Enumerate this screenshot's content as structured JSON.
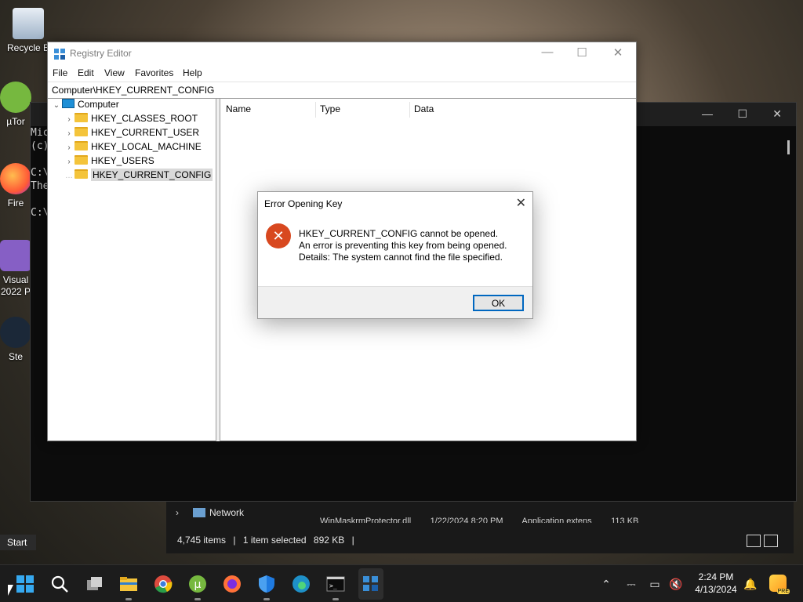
{
  "desktop": {
    "icons": [
      {
        "label": "Recycle B",
        "name": "recycle-bin"
      },
      {
        "label": "µTor",
        "name": "utorrent"
      },
      {
        "label": "Fire",
        "name": "firefox"
      },
      {
        "label": "Visual 2022 P",
        "name": "visual-studio"
      },
      {
        "label": "Ste",
        "name": "steam"
      }
    ]
  },
  "cmd": {
    "lines": [
      "Mic",
      "(c)",
      "",
      "C:\\",
      "The",
      "",
      "C:\\"
    ]
  },
  "explorer": {
    "network_label": "Network",
    "partial_row": "WinMaskrmProtector.dll        1/22/2024 8:20 PM        Application extens        113 KB",
    "status": {
      "items": "4,745 items",
      "selected": "1 item selected",
      "size": "892 KB"
    }
  },
  "regedit": {
    "title": "Registry Editor",
    "menu": [
      "File",
      "Edit",
      "View",
      "Favorites",
      "Help"
    ],
    "address": "Computer\\HKEY_CURRENT_CONFIG",
    "tree": {
      "root": "Computer",
      "keys": [
        "HKEY_CLASSES_ROOT",
        "HKEY_CURRENT_USER",
        "HKEY_LOCAL_MACHINE",
        "HKEY_USERS",
        "HKEY_CURRENT_CONFIG"
      ]
    },
    "columns": [
      "Name",
      "Type",
      "Data"
    ]
  },
  "dialog": {
    "title": "Error Opening Key",
    "line1": "HKEY_CURRENT_CONFIG cannot be opened.",
    "line2": "An error is preventing this key from being opened.",
    "line3": "Details: The system cannot find the file specified.",
    "ok_label": "OK"
  },
  "start_tooltip": "Start",
  "taskbar": {
    "time": "2:24 PM",
    "date": "4/13/2024",
    "copilot_badge": "PRE"
  },
  "colors": {
    "accent": "#0067c0",
    "error": "#d8481f",
    "folder": "#f4c43b"
  }
}
